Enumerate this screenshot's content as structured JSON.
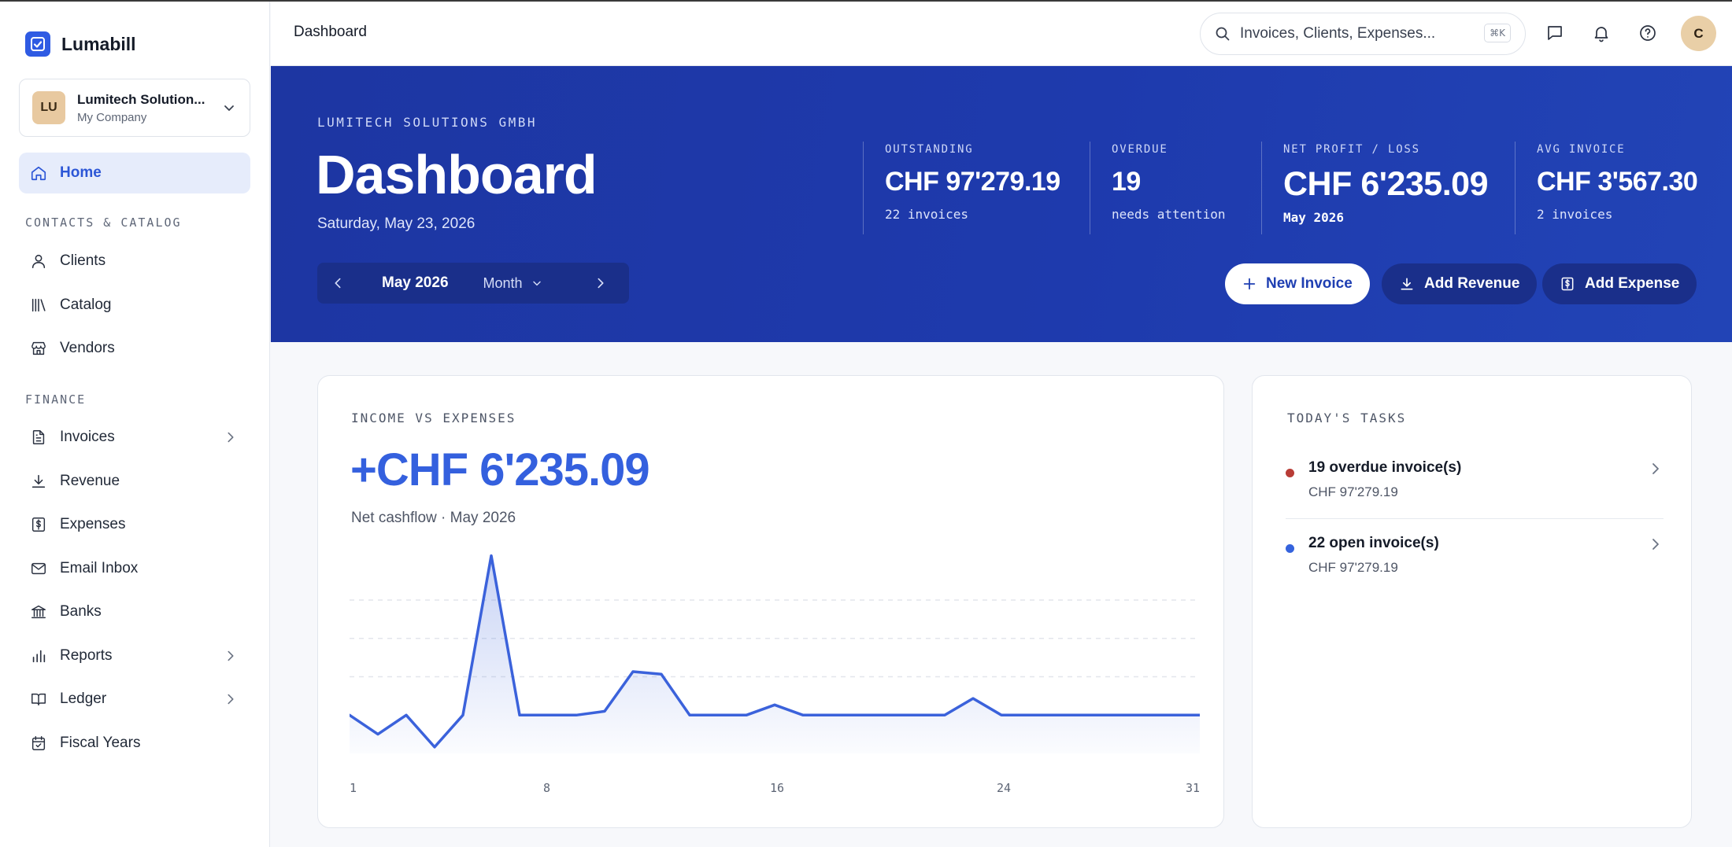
{
  "brand": {
    "name": "Lumabill"
  },
  "company": {
    "initials": "LU",
    "name": "Lumitech Solution...",
    "sub": "My Company"
  },
  "sidebar": {
    "home": "Home",
    "contacts_section": "CONTACTS & CATALOG",
    "contacts": [
      "Clients",
      "Catalog",
      "Vendors"
    ],
    "finance_section": "FINANCE",
    "finance": [
      "Invoices",
      "Revenue",
      "Expenses",
      "Email Inbox",
      "Banks",
      "Reports",
      "Ledger",
      "Fiscal Years"
    ]
  },
  "topbar": {
    "title": "Dashboard",
    "search_placeholder": "Invoices, Clients, Expenses...",
    "shortcut": "⌘K",
    "user_initial": "C"
  },
  "hero": {
    "company": "LUMITECH SOLUTIONS GMBH",
    "title": "Dashboard",
    "date": "Saturday, May 23, 2026",
    "period": {
      "month": "May 2026",
      "granularity": "Month"
    },
    "stats": [
      {
        "label": "OUTSTANDING",
        "value": "CHF 97'279.19",
        "sub": "22 invoices"
      },
      {
        "label": "OVERDUE",
        "value": "19",
        "sub": "needs attention"
      },
      {
        "label": "NET PROFIT / LOSS",
        "value": "CHF 6'235.09",
        "sub": "May 2026"
      },
      {
        "label": "AVG INVOICE",
        "value": "CHF 3'567.30",
        "sub": "2 invoices"
      }
    ],
    "buttons": {
      "new_invoice": "New Invoice",
      "add_revenue": "Add Revenue",
      "add_expense": "Add Expense"
    }
  },
  "income_card": {
    "label": "INCOME VS EXPENSES",
    "net_value": "+CHF 6'235.09",
    "sub": "Net cashflow · May 2026"
  },
  "chart_data": {
    "type": "area",
    "title": "",
    "xlabel": "",
    "ylabel": "",
    "x": [
      1,
      2,
      3,
      4,
      5,
      6,
      7,
      8,
      9,
      10,
      11,
      12,
      13,
      14,
      15,
      16,
      17,
      18,
      19,
      20,
      21,
      22,
      23,
      24,
      25,
      26,
      27,
      28,
      29,
      30,
      31
    ],
    "values": [
      0,
      -750,
      0,
      -1250,
      0,
      6235,
      0,
      0,
      0,
      150,
      1700,
      1600,
      0,
      0,
      0,
      400,
      0,
      0,
      0,
      0,
      0,
      0,
      650,
      0,
      0,
      0,
      0,
      0,
      0,
      0,
      0
    ],
    "x_ticks": [
      "1",
      "8",
      "16",
      "24",
      "31"
    ],
    "ylim": [
      -1500,
      6500
    ],
    "grid": "dashed-horizontal",
    "line_color": "#3b62db",
    "legend": "none"
  },
  "tasks": {
    "label": "TODAY'S TASKS",
    "items": [
      {
        "title": "19 overdue invoice(s)",
        "amount": "CHF 97'279.19",
        "color": "#b83c36"
      },
      {
        "title": "22 open invoice(s)",
        "amount": "CHF 97'279.19",
        "color": "#3563dd"
      }
    ]
  },
  "colors": {
    "accent": "#2f5be3",
    "hero": "#1e3aad",
    "overdue": "#b83c36"
  }
}
